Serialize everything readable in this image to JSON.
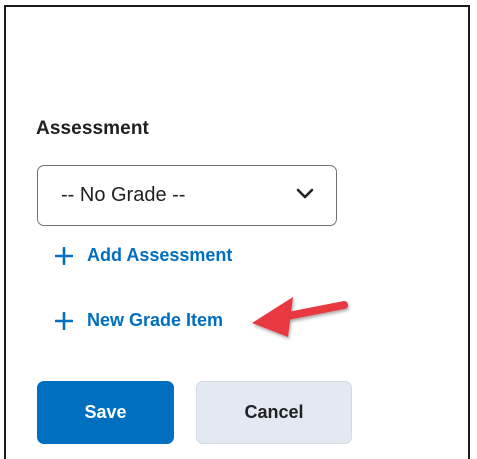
{
  "assessment": {
    "label": "Assessment",
    "select": {
      "value": "-- No Grade --",
      "icon": "chevron-down-icon"
    },
    "add_assessment": {
      "icon": "plus-icon",
      "label": "Add Assessment"
    },
    "new_grade_item": {
      "icon": "plus-icon",
      "label": "New Grade Item"
    }
  },
  "annotation": {
    "icon": "red-arrow-icon",
    "color": "#e8393f"
  },
  "actions": {
    "save_label": "Save",
    "cancel_label": "Cancel"
  },
  "colors": {
    "link": "#006fbf",
    "primary": "#006fbf",
    "secondary_bg": "#e3e9f1"
  }
}
